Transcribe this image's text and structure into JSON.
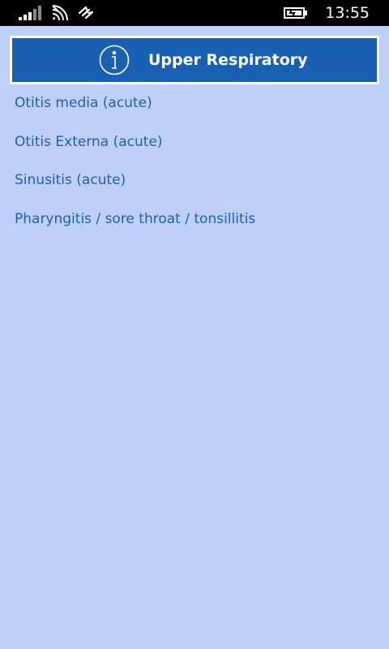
{
  "status_bar": {
    "time": "13:55",
    "icons": [
      "signal-bars-icon",
      "wifi-icon",
      "data-switch-icon",
      "battery-charging-icon"
    ]
  },
  "header": {
    "title": "Upper Respiratory",
    "icon": "info-icon"
  },
  "topics": [
    {
      "label": "Otitis media (acute)"
    },
    {
      "label": "Otitis Externa (acute)"
    },
    {
      "label": "Sinusitis (acute)"
    },
    {
      "label": "Pharyngitis / sore throat / tonsillitis"
    }
  ],
  "colors": {
    "background": "#bed0f7",
    "header_fill": "#1a60b2",
    "link_text": "#1c60b0",
    "status_bar": "#000000"
  }
}
